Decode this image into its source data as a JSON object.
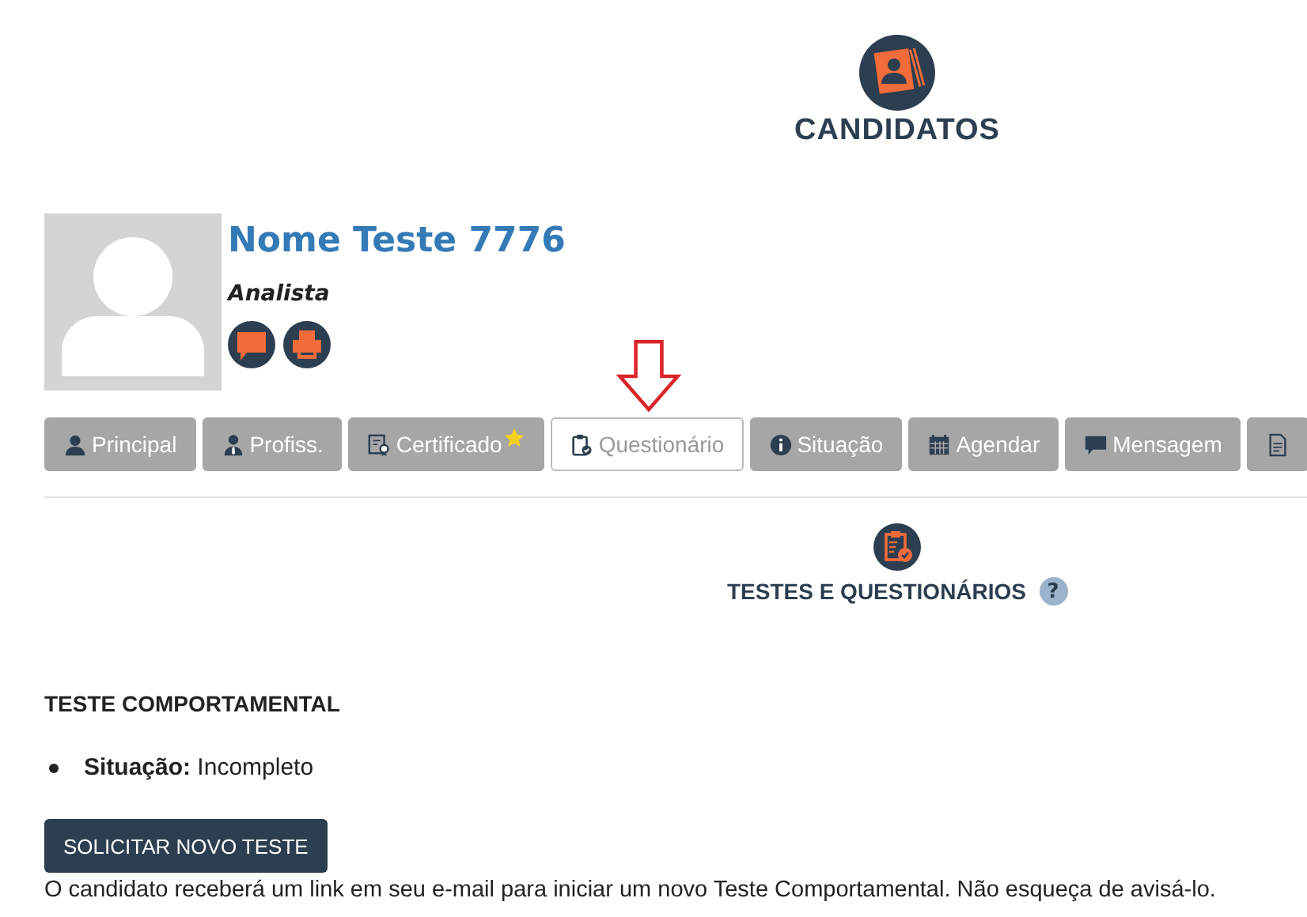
{
  "header": {
    "title": "CANDIDATOS"
  },
  "candidate": {
    "name": "Nome Teste 7776",
    "role": "Analista"
  },
  "tabs": [
    {
      "label": "Principal",
      "selected": false
    },
    {
      "label": "Profiss.",
      "selected": false
    },
    {
      "label": "Certificado",
      "starred": true,
      "selected": false
    },
    {
      "label": "Questionário",
      "selected": true
    },
    {
      "label": "Situação",
      "selected": false
    },
    {
      "label": "Agendar",
      "selected": false
    },
    {
      "label": "Mensagem",
      "selected": false
    },
    {
      "selected": false
    }
  ],
  "section": {
    "title": "TESTES E QUESTIONÁRIOS",
    "help": "?"
  },
  "test": {
    "title": "TESTE COMPORTAMENTAL",
    "status_label": "Situação:",
    "status": "Incompleto",
    "button": "SOLICITAR NOVO TESTE",
    "note": "O candidato receberá um link em seu e-mail para iniciar um novo Teste Comportamental. Não esqueça de avisá-lo."
  }
}
